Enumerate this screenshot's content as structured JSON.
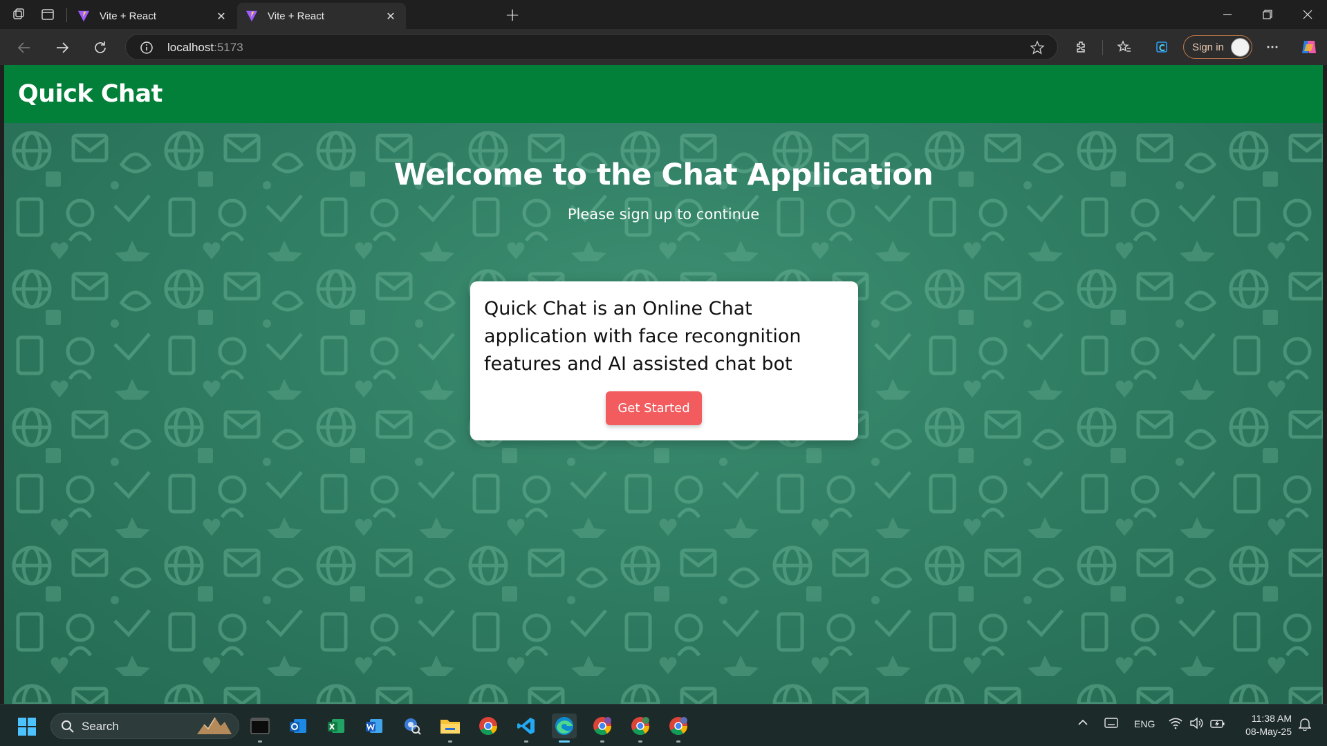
{
  "browser": {
    "tabs": [
      {
        "title": "Vite + React",
        "active": false
      },
      {
        "title": "Vite + React",
        "active": true
      }
    ],
    "address": {
      "host": "localhost",
      "port": ":5173"
    },
    "signin_label": "Sign in"
  },
  "app": {
    "header_title": "Quick Chat",
    "welcome_title": "Welcome to the Chat Application",
    "welcome_subtitle": "Please sign up to continue",
    "card_text": "Quick Chat is an Online Chat application with face recongnition features and AI assisted chat bot",
    "cta_label": "Get Started",
    "colors": {
      "header": "#027f38",
      "cta": "#f25c5f",
      "background": "#2f7a60"
    }
  },
  "taskbar": {
    "search_label": "Search",
    "language": "ENG",
    "time": "11:38 AM",
    "date": "08-May-25",
    "apps": [
      "terminal-icon",
      "outlook-icon",
      "excel-icon",
      "word-icon",
      "settings-search-icon",
      "file-explorer-icon",
      "chrome-icon",
      "vscode-icon",
      "edge-icon",
      "chrome-profile-1-icon",
      "chrome-profile-2-icon",
      "chrome-profile-3-icon"
    ]
  }
}
